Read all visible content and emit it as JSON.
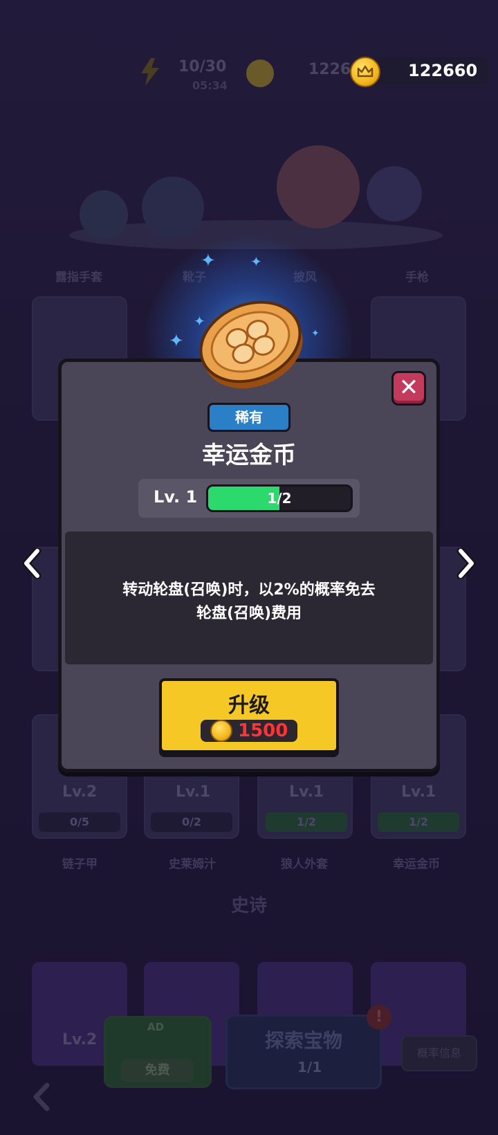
{
  "hud": {
    "energy": "10/30",
    "timer": "05:34",
    "crowns": "1226",
    "gold": "122660"
  },
  "background": {
    "top_labels": [
      "露指手套",
      "靴子",
      "披风",
      "手枪"
    ],
    "cards_row3": [
      {
        "name": "链子甲",
        "lv": "Lv.2",
        "progress": "0/5"
      },
      {
        "name": "史莱姆汁",
        "lv": "Lv.1",
        "progress": "0/2"
      },
      {
        "name": "狼人外套",
        "lv": "Lv.1",
        "progress": "1/2"
      },
      {
        "name": "幸运金币",
        "lv": "Lv.1",
        "progress": "1/2"
      }
    ],
    "section_title": "史诗",
    "epic_lv": "Lv.2",
    "ad_label": "AD",
    "free_label": "免费",
    "explore_title": "探索宝物",
    "explore_count": "1/1",
    "prob_info": "概率信息"
  },
  "modal": {
    "rarity": "稀有",
    "item_name": "幸运金币",
    "level": "Lv. 1",
    "progress_text": "1/2",
    "progress_fraction": 0.5,
    "description_line1": "转动轮盘(召唤)时，以2%的概率免去",
    "description_line2": "轮盘(召唤)费用",
    "upgrade_label": "升级",
    "upgrade_cost": "1500",
    "close_symbol": "✕"
  },
  "colors": {
    "rarity_blue": "#2a7fc6",
    "progress_green": "#2bd96c",
    "upgrade_yellow": "#f5c825",
    "cost_red": "#ff3434",
    "close_red": "#c23a5c"
  }
}
